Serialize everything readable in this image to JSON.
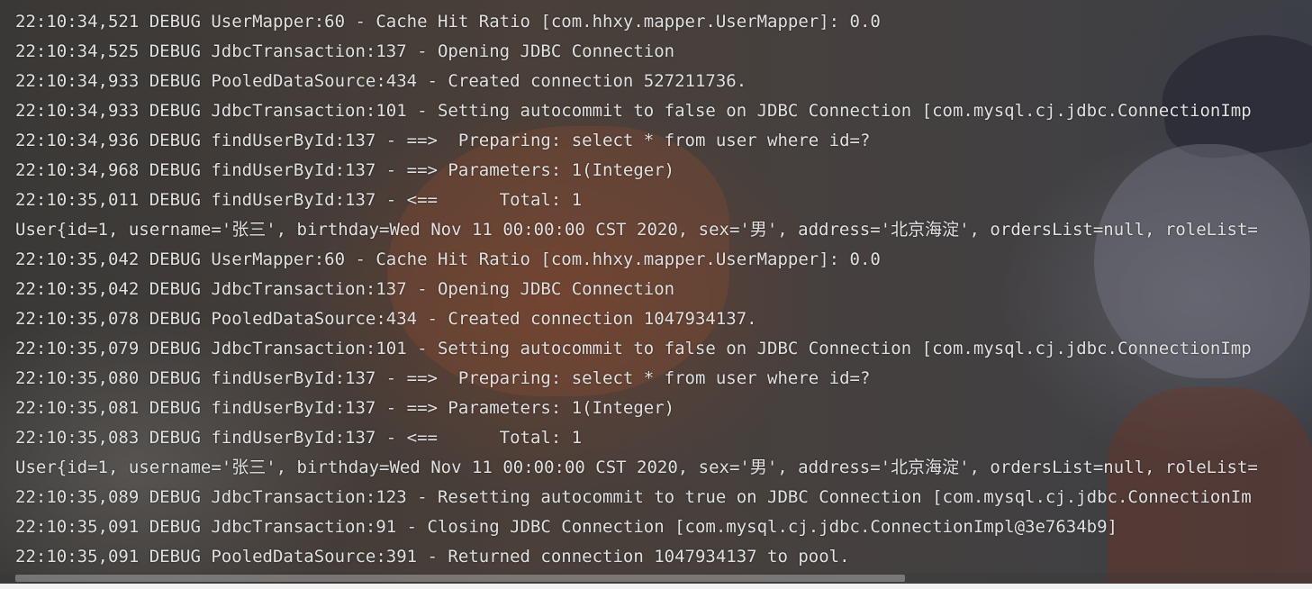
{
  "console": {
    "lines": [
      "22:10:34,521 DEBUG UserMapper:60 - Cache Hit Ratio [com.hhxy.mapper.UserMapper]: 0.0",
      "22:10:34,525 DEBUG JdbcTransaction:137 - Opening JDBC Connection",
      "22:10:34,933 DEBUG PooledDataSource:434 - Created connection 527211736.",
      "22:10:34,933 DEBUG JdbcTransaction:101 - Setting autocommit to false on JDBC Connection [com.mysql.cj.jdbc.ConnectionImp",
      "22:10:34,936 DEBUG findUserById:137 - ==>  Preparing: select * from user where id=?",
      "22:10:34,968 DEBUG findUserById:137 - ==> Parameters: 1(Integer)",
      "22:10:35,011 DEBUG findUserById:137 - <==      Total: 1",
      "User{id=1, username='张三', birthday=Wed Nov 11 00:00:00 CST 2020, sex='男', address='北京海淀', ordersList=null, roleList=",
      "22:10:35,042 DEBUG UserMapper:60 - Cache Hit Ratio [com.hhxy.mapper.UserMapper]: 0.0",
      "22:10:35,042 DEBUG JdbcTransaction:137 - Opening JDBC Connection",
      "22:10:35,078 DEBUG PooledDataSource:434 - Created connection 1047934137.",
      "22:10:35,079 DEBUG JdbcTransaction:101 - Setting autocommit to false on JDBC Connection [com.mysql.cj.jdbc.ConnectionImp",
      "22:10:35,080 DEBUG findUserById:137 - ==>  Preparing: select * from user where id=?",
      "22:10:35,081 DEBUG findUserById:137 - ==> Parameters: 1(Integer)",
      "22:10:35,083 DEBUG findUserById:137 - <==      Total: 1",
      "User{id=1, username='张三', birthday=Wed Nov 11 00:00:00 CST 2020, sex='男', address='北京海淀', ordersList=null, roleList=",
      "22:10:35,089 DEBUG JdbcTransaction:123 - Resetting autocommit to true on JDBC Connection [com.mysql.cj.jdbc.ConnectionIm",
      "22:10:35,091 DEBUG JdbcTransaction:91 - Closing JDBC Connection [com.mysql.cj.jdbc.ConnectionImpl@3e7634b9]",
      "22:10:35,091 DEBUG PooledDataSource:391 - Returned connection 1047934137 to pool."
    ]
  },
  "colors": {
    "text": "#e0e0e0",
    "background": "#2b2b2b"
  }
}
